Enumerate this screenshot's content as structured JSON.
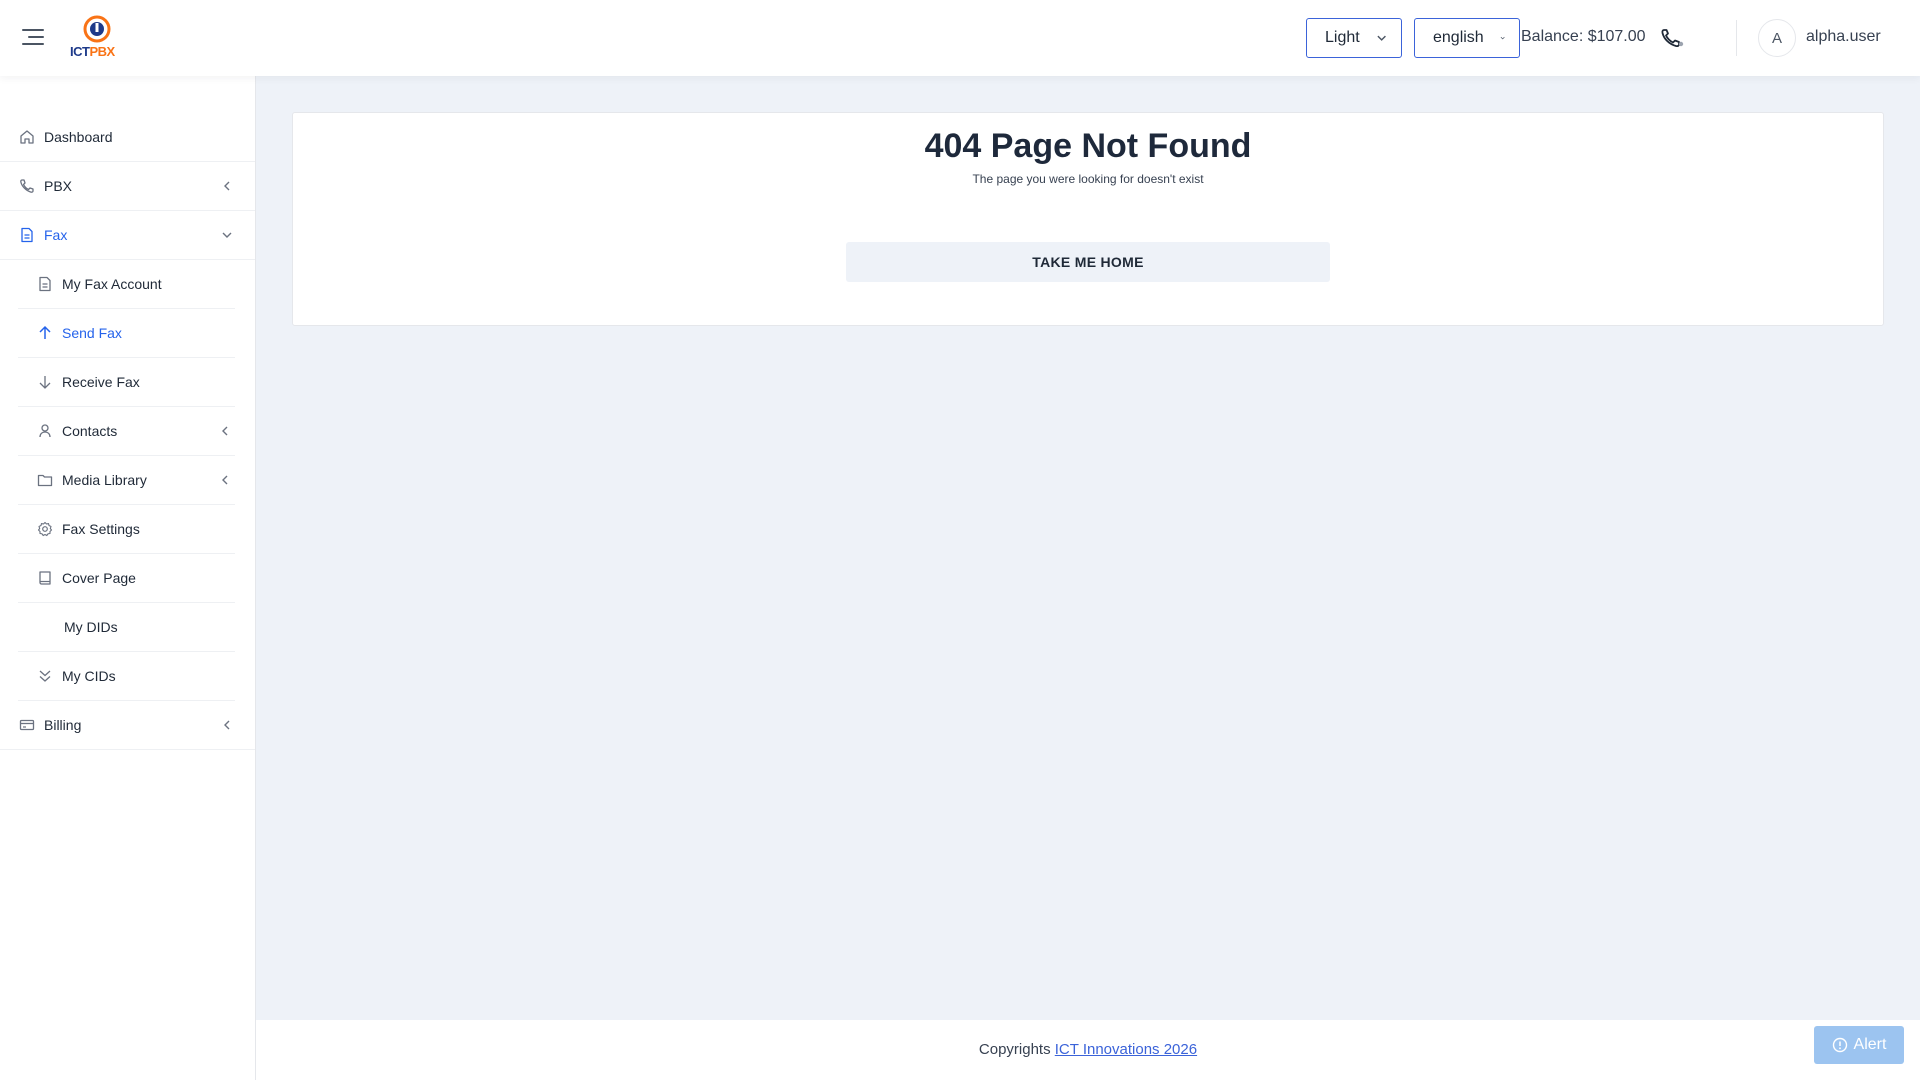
{
  "header": {
    "logo": {
      "text_a": "ICT",
      "text_b": "PBX"
    },
    "theme_select": {
      "value": "Light"
    },
    "language_select": {
      "value": "english"
    },
    "balance": "Balance: $107.00",
    "user": {
      "avatar_initial": "A",
      "name": "alpha.user"
    }
  },
  "sidebar": {
    "items": [
      {
        "label": "Dashboard",
        "icon": "home-icon"
      },
      {
        "label": "PBX",
        "icon": "phone-icon"
      },
      {
        "label": "Fax",
        "icon": "document-icon"
      },
      {
        "label": "Billing",
        "icon": "credit-card-icon"
      }
    ],
    "fax_sub": [
      {
        "label": "My Fax Account",
        "icon": "document-icon"
      },
      {
        "label": "Send Fax",
        "icon": "arrow-up-icon"
      },
      {
        "label": "Receive Fax",
        "icon": "arrow-down-icon"
      },
      {
        "label": "Contacts",
        "icon": "user-icon"
      },
      {
        "label": "Media Library",
        "icon": "folder-icon"
      },
      {
        "label": "Fax Settings",
        "icon": "gear-icon"
      },
      {
        "label": "Cover Page",
        "icon": "book-icon"
      },
      {
        "label": "My DIDs",
        "icon": ""
      },
      {
        "label": "My CIDs",
        "icon": "double-chevron-down-icon"
      }
    ]
  },
  "main": {
    "title": "404 Page Not Found",
    "subtitle": "The page you were looking for doesn't exist",
    "home_button": "TAKE ME HOME"
  },
  "footer": {
    "prefix": "Copyrights",
    "link_text": "ICT Innovations 2026"
  },
  "alert_button": "Alert",
  "colors": {
    "accent": "#2563eb",
    "background": "#eef2f8",
    "alert": "#9cc4f0",
    "logo_orange": "#f97316",
    "logo_blue": "#1e3a8a"
  }
}
